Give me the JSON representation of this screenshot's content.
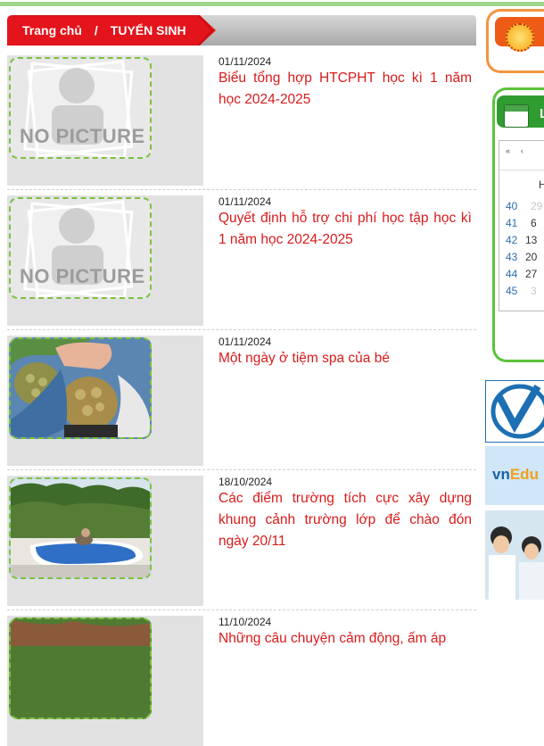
{
  "breadcrumb": {
    "home": "Trang chủ",
    "separator": "/",
    "current": "TUYỂN SINH"
  },
  "placeholder_image_text": "NO PICTURE",
  "news": [
    {
      "date": "01/11/2024",
      "title": "Biểu tổng hợp HTCPHT học kì 1 năm học 2024-2025",
      "image": "no-picture"
    },
    {
      "date": "01/11/2024",
      "title": "Quyết định hỗ trợ chi phí học tập học kì 1 năm học 2024-2025",
      "image": "no-picture"
    },
    {
      "date": "01/11/2024",
      "title": "Một ngày ở tiệm spa của bé",
      "image": "photo-spa"
    },
    {
      "date": "18/10/2024",
      "title": "Các điểm trường tích cực xây dựng khung cảnh trường lớp để chào đón ngày 20/11",
      "image": "photo-schoolyard"
    },
    {
      "date": "11/10/2024",
      "title": "Những câu chuyện cảm động, ấm áp",
      "image": "photo-garden"
    }
  ],
  "sidebar": {
    "box1_label": "V",
    "box2_label": "L",
    "calendar": {
      "nav": [
        "«",
        "‹"
      ],
      "header": "H",
      "weeks": [
        "40",
        "41",
        "42",
        "43",
        "44",
        "45"
      ],
      "days": [
        "29",
        "6",
        "13",
        "20",
        "27",
        "3"
      ]
    },
    "banner_vnedu": {
      "part1": "vn",
      "part2": "Edu"
    }
  },
  "colors": {
    "accent_red": "#d81b1b",
    "breadcrumb_red": "#e3141b",
    "frame_green": "#7cc240",
    "sidebar_orange": "#ee5b17",
    "sidebar_green": "#2f9c2f"
  }
}
